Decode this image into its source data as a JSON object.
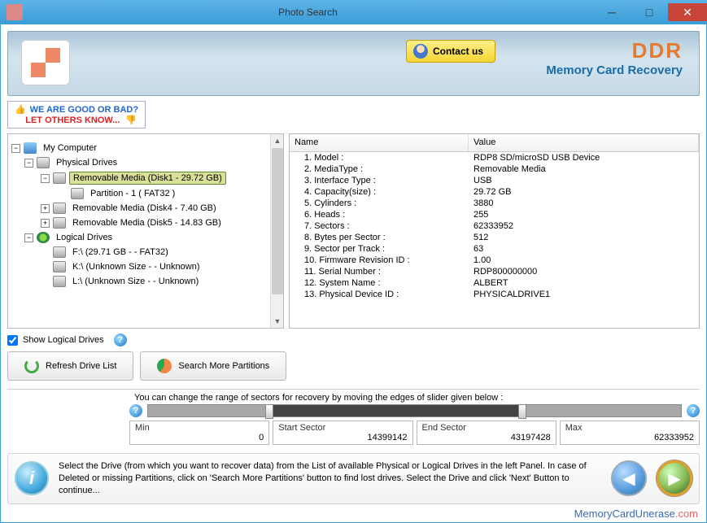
{
  "window": {
    "title": "Photo Search"
  },
  "banner": {
    "contact": "Contact us",
    "brand": "DDR",
    "brand_sub": "Memory Card Recovery"
  },
  "feedback": {
    "l1": "WE ARE GOOD OR BAD?",
    "l2": "LET OTHERS KNOW..."
  },
  "tree": {
    "root": "My Computer",
    "physical": "Physical Drives",
    "removable1": "Removable Media (Disk1 - 29.72 GB)",
    "partition1": "Partition - 1 ( FAT32 )",
    "removable4": "Removable Media (Disk4 - 7.40 GB)",
    "removable5": "Removable Media (Disk5 - 14.83 GB)",
    "logical": "Logical Drives",
    "f": "F:\\ (29.71 GB  -  - FAT32)",
    "k": "K:\\ (Unknown Size  -  - Unknown)",
    "l": "L:\\ (Unknown Size  -  - Unknown)"
  },
  "table": {
    "head_name": "Name",
    "head_value": "Value",
    "rows": [
      {
        "name": "1. Model :",
        "value": "RDP8 SD/microSD USB Device"
      },
      {
        "name": "2. MediaType :",
        "value": "Removable Media"
      },
      {
        "name": "3. Interface Type :",
        "value": "USB"
      },
      {
        "name": "4. Capacity(size) :",
        "value": "29.72 GB"
      },
      {
        "name": "5. Cylinders :",
        "value": "3880"
      },
      {
        "name": "6. Heads :",
        "value": "255"
      },
      {
        "name": "7. Sectors :",
        "value": "62333952"
      },
      {
        "name": "8. Bytes per Sector :",
        "value": "512"
      },
      {
        "name": "9. Sector per Track :",
        "value": "63"
      },
      {
        "name": "10. Firmware Revision ID :",
        "value": "1.00"
      },
      {
        "name": "11. Serial Number :",
        "value": "RDP800000000"
      },
      {
        "name": "12. System Name :",
        "value": "ALBERT"
      },
      {
        "name": "13. Physical Device ID :",
        "value": "PHYSICALDRIVE1"
      }
    ]
  },
  "controls": {
    "show_logical": "Show Logical Drives",
    "refresh": "Refresh Drive List",
    "search_more": "Search More Partitions"
  },
  "slider": {
    "text": "You can change the range of sectors for recovery by moving the edges of slider given below :",
    "min_label": "Min",
    "min_val": "0",
    "start_label": "Start Sector",
    "start_val": "14399142",
    "end_label": "End Sector",
    "end_val": "43197428",
    "max_label": "Max",
    "max_val": "62333952"
  },
  "footer": {
    "text": "Select the Drive (from which you want to recover data) from the List of available Physical or Logical Drives in the left Panel. In case of Deleted or missing Partitions, click on 'Search More Partitions' button to find lost drives. Select the Drive and click 'Next' Button to continue..."
  },
  "link": {
    "a": "MemoryCardUnerase",
    "b": ".com"
  }
}
